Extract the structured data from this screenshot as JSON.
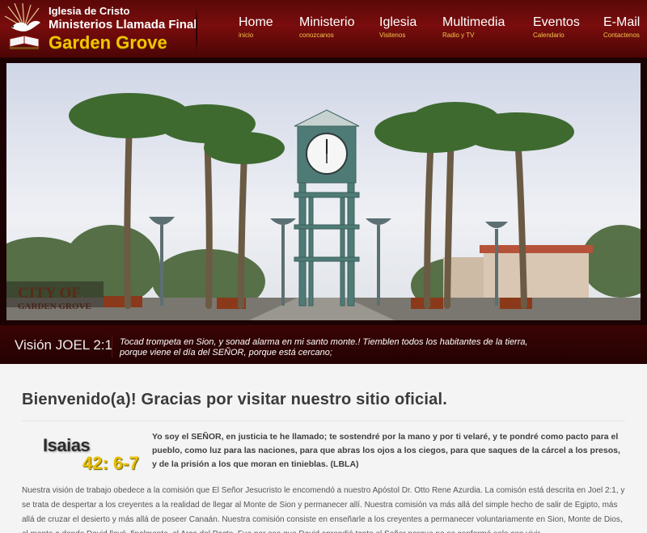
{
  "header": {
    "brand_line1": "Iglesia de Cristo",
    "brand_line2": "Ministerios Llamada Final",
    "brand_line3": "Garden Grove"
  },
  "nav": [
    {
      "label": "Home",
      "sub": "inicio"
    },
    {
      "label": "Ministerio",
      "sub": "conozcanos"
    },
    {
      "label": "Iglesia",
      "sub": "Visitenos"
    },
    {
      "label": "Multimedia",
      "sub": "Radio y TV"
    },
    {
      "label": "Eventos",
      "sub": "Calendario"
    },
    {
      "label": "E-Mail",
      "sub": "Contactenos"
    }
  ],
  "hero": {
    "sign_line1": "CITY OF",
    "sign_line2": "GARDEN GROVE"
  },
  "vision": {
    "title": "Visión JOEL 2:1",
    "text_line1": "Tocad trompeta en Sion, y sonad alarma en mi santo monte.! Tiemblen todos los habitantes de la tierra,",
    "text_line2": "porque viene el día del SEÑOR, porque está cercano;"
  },
  "content": {
    "welcome": "Bienvenido(a)! Gracias por visitar nuestro sitio oficial.",
    "verse_book": "Isaias",
    "verse_ref": "42: 6-7",
    "quote": "Yo soy el SEÑOR, en justicia te he llamado; te sostendré por la mano y por ti velaré, y te pondré como pacto para el pueblo, como luz para las naciones, para que abras los ojos a los ciegos, para que saques de la cárcel a los presos, y de la prisión a los que moran en tinieblas. (LBLA)",
    "body": "Nuestra visión de trabajo obedece a la comisión que El Señor Jesucristo le encomendó a nuestro Apóstol Dr. Otto Rene Azurdia. La comisón está descrita en Joel 2:1, y se trata de despertar a los creyentes a la realidad de llegar al Monte de Sion y permanecer allí. Nuestra comisión va más allá del simple hecho de salir de Egipto, más allá de cruzar el desierto y más allá de poseer Canaán. Nuestra comisión consiste en enseñarle a los creyentes a permanecer voluntariamente en Sion, Monte de Dios, el monte a donde David llevó, finalmente, el Arca del Pacto. Fue por eso que David aprendió tanto el Señor porque no se conformó solo con vivir"
  },
  "colors": {
    "header_bg": "#6e0b0b",
    "brand_gold": "#f2c400",
    "nav_sub": "#f5c84a",
    "vision_bg": "#2c0303",
    "page_bg": "#f4f4f4"
  }
}
